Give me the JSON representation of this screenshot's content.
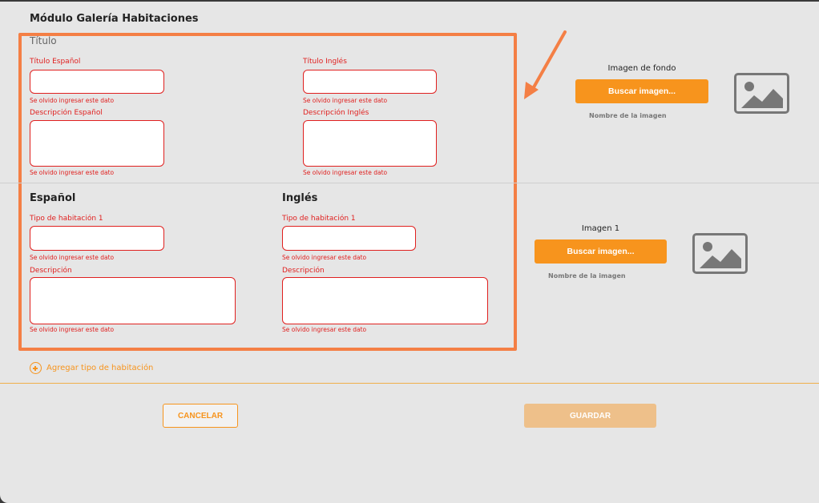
{
  "module": {
    "title": "Módulo Galería Habitaciones"
  },
  "titulo_section": {
    "heading": "Título",
    "title_es_label": "Título Español",
    "title_en_label": "Título Inglés",
    "desc_es_label": "Descripción Español",
    "desc_en_label": "Descripción Inglés",
    "error_msg": "Se olvido ingresar este dato"
  },
  "background_image": {
    "label": "Imagen de fondo",
    "button": "Buscar imagen...",
    "filename": "Nombre de la imagen",
    "icon": "image-icon"
  },
  "room_types": {
    "es_heading": "Español",
    "en_heading": "Inglés",
    "type_label": "Tipo de habitación 1",
    "desc_label": "Descripción",
    "error_msg": "Se olvido ingresar este dato"
  },
  "image1": {
    "label": "Imagen 1",
    "button": "Buscar imagen...",
    "filename": "Nombre de la imagen",
    "icon": "image-icon"
  },
  "add_room_type": {
    "label": "Agregar tipo de habitación"
  },
  "actions": {
    "cancel": "CANCELAR",
    "save": "GUARDAR"
  },
  "colors": {
    "accent": "#f7941d",
    "error": "#e0201f",
    "highlight": "#f47f45",
    "save_disabled": "#eec08a"
  }
}
